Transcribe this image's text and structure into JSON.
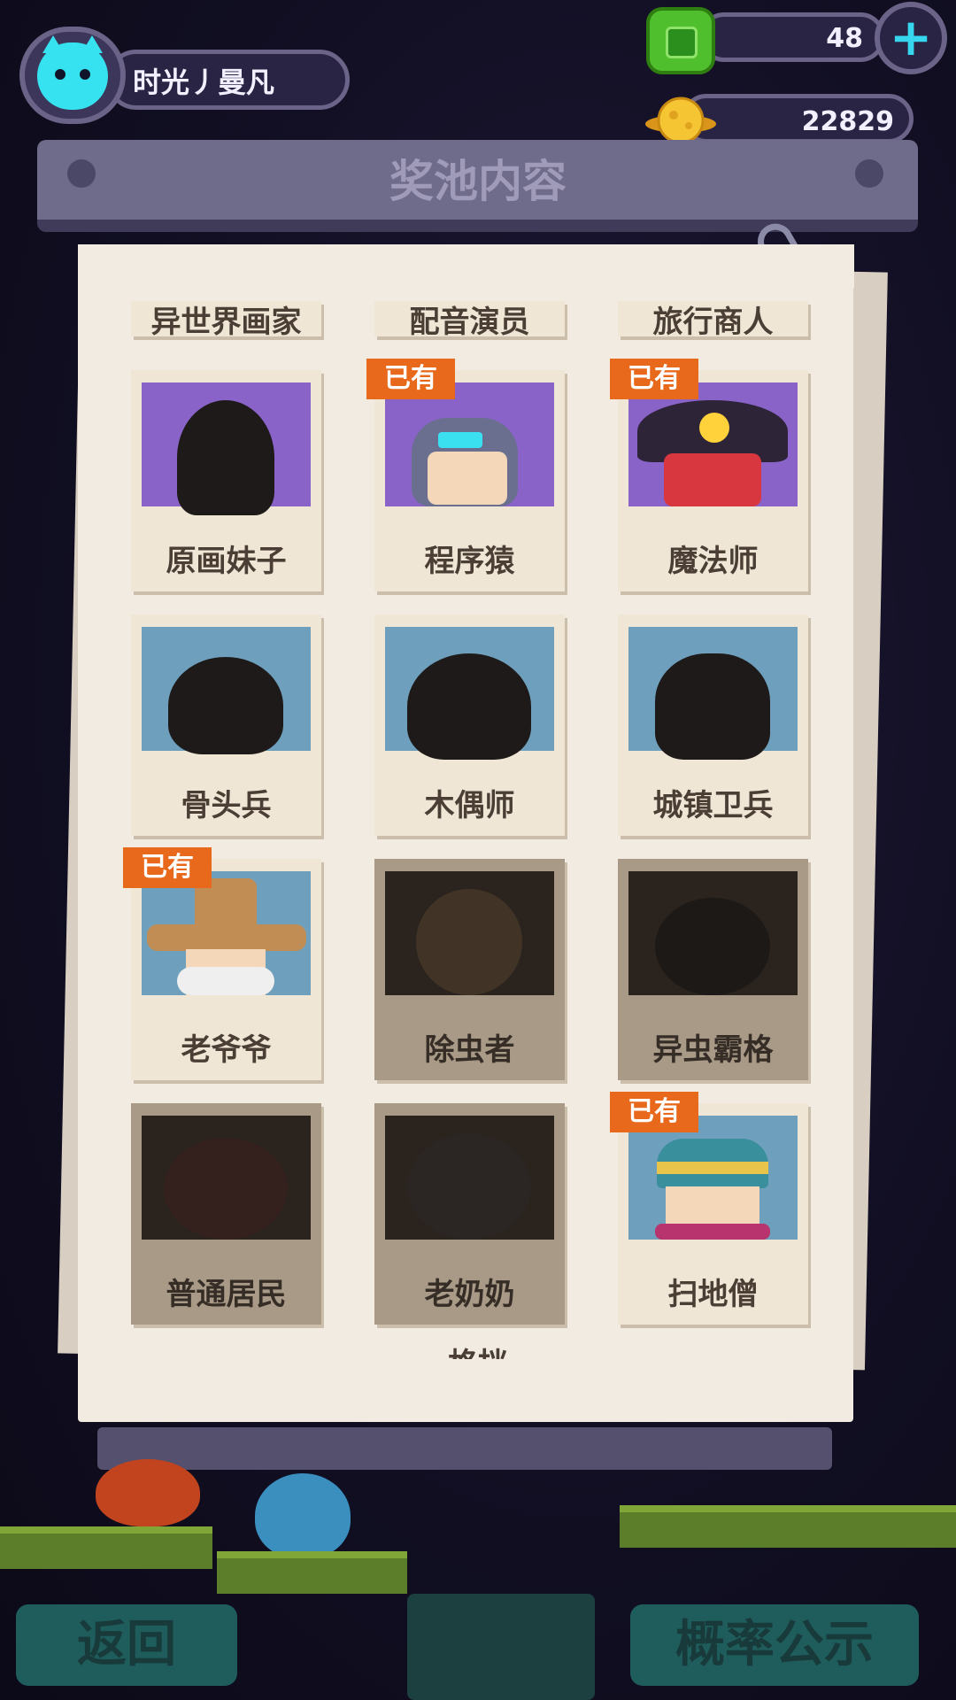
{
  "header": {
    "username": "时光丿曼凡",
    "gems": "48",
    "coins": "22829",
    "plus_label": "+"
  },
  "board": {
    "title": "奖池内容"
  },
  "top_row_labels": [
    "异世界画家",
    "配音演员",
    "旅行商人"
  ],
  "owned_badge": "已有",
  "cards": [
    {
      "name": "原画妹子",
      "owned": false
    },
    {
      "name": "程序猿",
      "owned": true
    },
    {
      "name": "魔法师",
      "owned": true
    },
    {
      "name": "骨头兵",
      "owned": false
    },
    {
      "name": "木偶师",
      "owned": false
    },
    {
      "name": "城镇卫兵",
      "owned": false
    },
    {
      "name": "老爷爷",
      "owned": true
    },
    {
      "name": "除虫者",
      "owned": false
    },
    {
      "name": "异虫霸格",
      "owned": false
    },
    {
      "name": "普通居民",
      "owned": false
    },
    {
      "name": "老奶奶",
      "owned": false
    },
    {
      "name": "扫地僧",
      "owned": true
    }
  ],
  "partial_next_label": "格挡",
  "bottom": {
    "back_label": "返回",
    "prob_label": "概率公示"
  },
  "colors": {
    "badge": "#e8691c",
    "accent": "#36e2f0",
    "paper": "#f1ebe2"
  }
}
